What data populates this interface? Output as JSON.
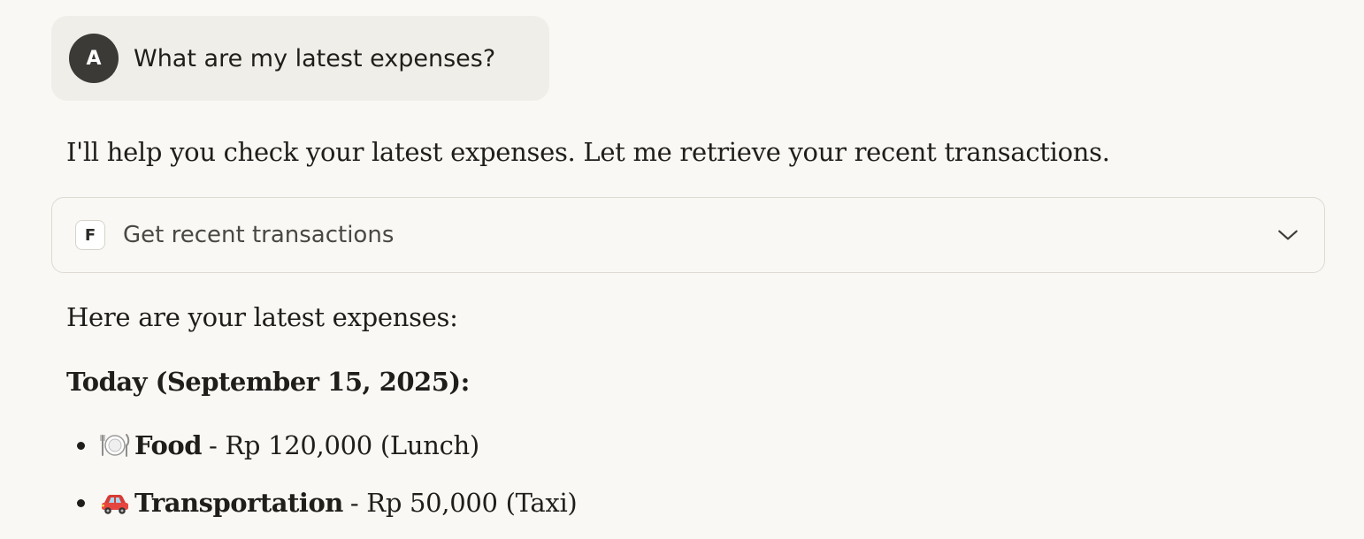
{
  "conversation": {
    "user": {
      "avatar_initial": "A",
      "message": "What are my latest expenses?"
    },
    "assistant_intro": "I'll help you check your latest expenses. Let me retrieve your recent transactions.",
    "tool_call": {
      "badge": "F",
      "label": "Get recent transactions",
      "expand_icon": "chevron-down-icon"
    },
    "response": {
      "intro": "Here are your latest expenses:",
      "section_heading": "Today (September 15, 2025):",
      "items": [
        {
          "icon": "plate-cutlery-icon",
          "category": "Food",
          "detail": "- Rp 120,000 (Lunch)"
        },
        {
          "icon": "car-icon",
          "category": "Transportation",
          "detail": "- Rp 50,000 (Taxi)"
        }
      ]
    }
  },
  "colors": {
    "page_background": "#f9f8f4",
    "user_bubble": "#f0eee8",
    "avatar": "#3b3a36",
    "text": "#1f1e1b",
    "border": "#dedad2"
  }
}
